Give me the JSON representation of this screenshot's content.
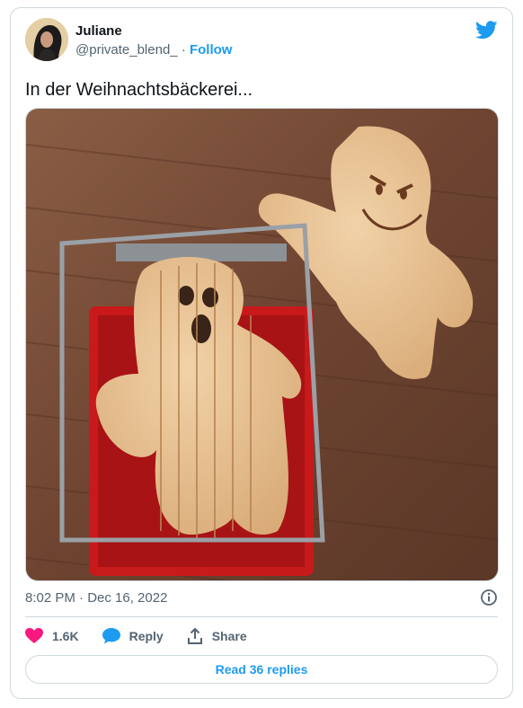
{
  "author": {
    "name": "Juliane",
    "handle": "@private_blend_",
    "separator": "·",
    "follow_label": "Follow"
  },
  "tweet": {
    "text": "In der Weihnachtsbäckerei...",
    "timestamp": "8:02 PM · Dec 16, 2022"
  },
  "actions": {
    "likes": "1.6K",
    "reply_label": "Reply",
    "share_label": "Share"
  },
  "read_replies_label": "Read 36 replies",
  "colors": {
    "accent": "#1d9bf0",
    "like": "#f91880",
    "muted": "#536471",
    "border": "#cfd9de"
  },
  "icons": [
    "twitter-bird-icon",
    "info-icon",
    "heart-icon",
    "reply-bubble-icon",
    "share-icon"
  ]
}
